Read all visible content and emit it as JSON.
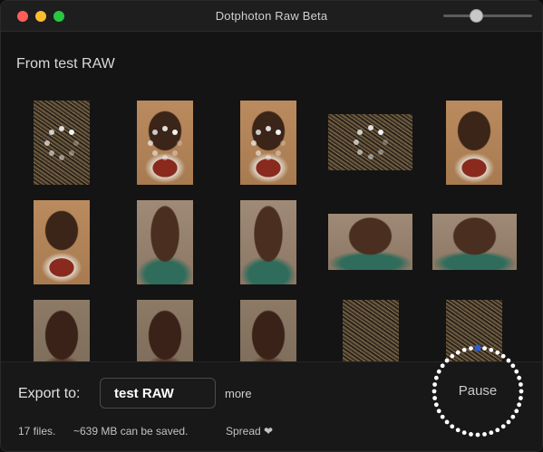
{
  "window": {
    "title": "Dotphoton Raw Beta"
  },
  "toolbar": {
    "zoom_level": 0.35
  },
  "section": {
    "title": "From test RAW"
  },
  "thumbnails": [
    {
      "subject": "dry grass texture",
      "processing": true
    },
    {
      "subject": "elderly man portrait",
      "processing": true
    },
    {
      "subject": "elderly man portrait",
      "processing": true
    },
    {
      "subject": "dry grass texture",
      "processing": true
    },
    {
      "subject": "elderly man portrait",
      "processing": false
    },
    {
      "subject": "elderly man portrait",
      "processing": false
    },
    {
      "subject": "young man portrait",
      "processing": false
    },
    {
      "subject": "young man portrait",
      "processing": false
    },
    {
      "subject": "young man portrait",
      "processing": false
    },
    {
      "subject": "young man portrait",
      "processing": false
    },
    {
      "subject": "child portrait",
      "processing": false
    },
    {
      "subject": "child portrait",
      "processing": false
    },
    {
      "subject": "child portrait",
      "processing": false
    },
    {
      "subject": "dry grass texture",
      "processing": false
    },
    {
      "subject": "dry grass texture",
      "processing": false
    }
  ],
  "export": {
    "label": "Export to:",
    "value": "test RAW",
    "more_label": "more"
  },
  "footer": {
    "files": "17 files.",
    "saved": "~639 MB can be saved.",
    "spread": "Spread ❤"
  },
  "pause": {
    "label": "Pause",
    "progress": 0.0
  },
  "colors": {
    "accent": "#2b5fd9",
    "background": "#141414"
  }
}
